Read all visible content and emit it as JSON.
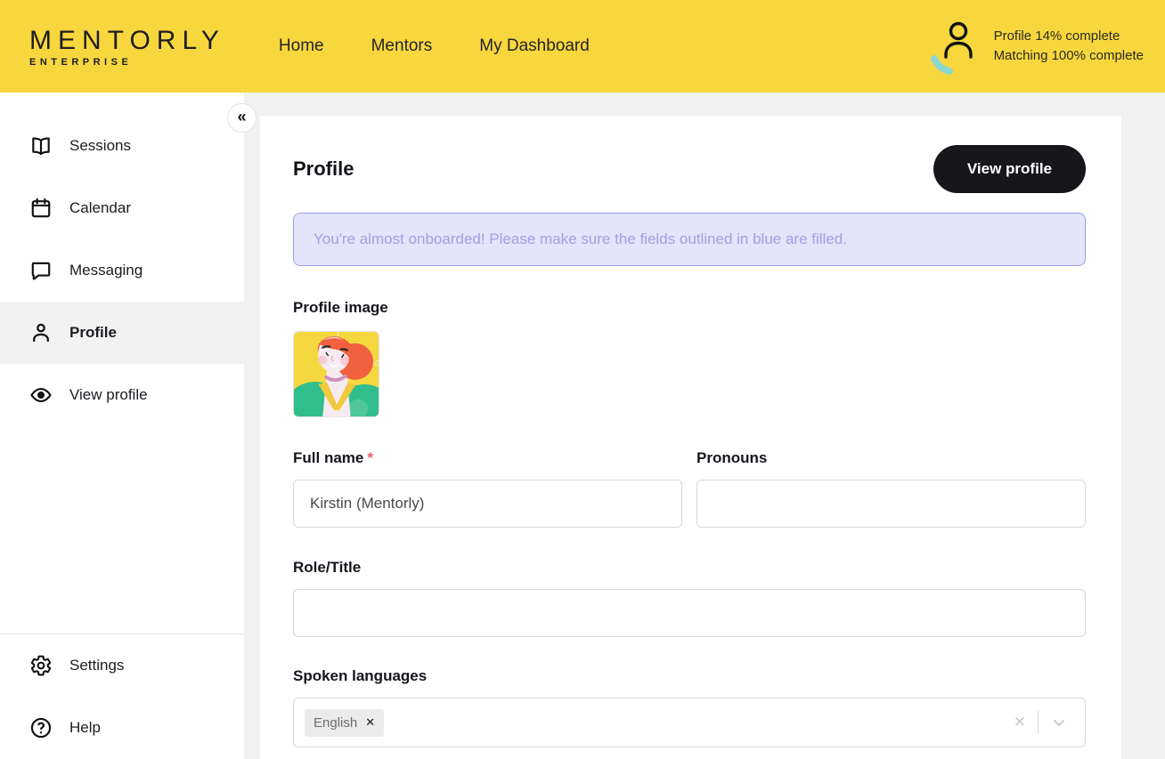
{
  "header": {
    "logo": {
      "title": "MENTORLY",
      "subtitle": "ENTERPRISE"
    },
    "nav": [
      {
        "label": "Home"
      },
      {
        "label": "Mentors"
      },
      {
        "label": "My Dashboard"
      }
    ],
    "profile_status": {
      "line1": "Profile 14% complete",
      "line2": "Matching 100% complete"
    }
  },
  "sidebar": {
    "collapse_glyph": "«",
    "items": [
      {
        "label": "Sessions",
        "icon": "book-icon"
      },
      {
        "label": "Calendar",
        "icon": "calendar-icon"
      },
      {
        "label": "Messaging",
        "icon": "chat-icon"
      },
      {
        "label": "Profile",
        "icon": "person-icon",
        "active": true
      },
      {
        "label": "View profile",
        "icon": "eye-icon"
      }
    ],
    "bottom_items": [
      {
        "label": "Settings",
        "icon": "gear-icon"
      },
      {
        "label": "Help",
        "icon": "help-icon"
      }
    ]
  },
  "main": {
    "title": "Profile",
    "view_profile_button": "View profile",
    "banner_text": "You're almost onboarded! Please make sure the fields outlined in blue are filled.",
    "profile_image_label": "Profile image",
    "fields": {
      "full_name": {
        "label": "Full name",
        "required_marker": "*",
        "value": "Kirstin (Mentorly)"
      },
      "pronouns": {
        "label": "Pronouns",
        "value": ""
      },
      "role_title": {
        "label": "Role/Title",
        "value": ""
      },
      "spoken_languages": {
        "label": "Spoken languages",
        "selected": [
          {
            "label": "English",
            "remove_glyph": "✕"
          }
        ],
        "clear_glyph": "✕"
      }
    }
  },
  "colors": {
    "header_yellow": "#F8D73E",
    "accent_teal": "#8ED7CE",
    "banner_bg": "#E4E4FA",
    "banner_border": "#9C9EEB",
    "banner_text": "#9FA1E3",
    "button_black": "#17171B",
    "required_red": "#EF6060",
    "active_item_bg": "#F2F2F2"
  }
}
